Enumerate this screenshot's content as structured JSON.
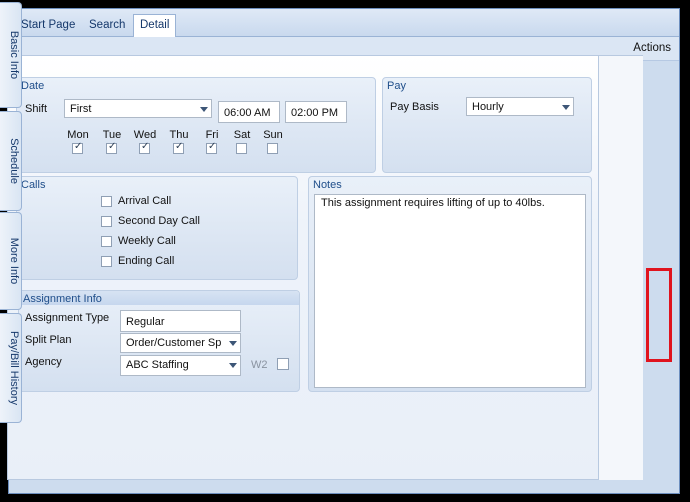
{
  "tabs": [
    "Start Page",
    "Search",
    "Detail"
  ],
  "actions_label": "Actions",
  "side_tabs": [
    "Basic Info",
    "Schedule",
    "More Info",
    "Pay/Bill History"
  ],
  "date_group": {
    "title": "Date",
    "shift_label": "Shift",
    "shift_value": "First",
    "start_time": "06:00 AM",
    "end_time": "02:00 PM",
    "days": [
      {
        "label": "Mon",
        "checked": true
      },
      {
        "label": "Tue",
        "checked": true
      },
      {
        "label": "Wed",
        "checked": true
      },
      {
        "label": "Thu",
        "checked": true
      },
      {
        "label": "Fri",
        "checked": true
      },
      {
        "label": "Sat",
        "checked": false
      },
      {
        "label": "Sun",
        "checked": false
      }
    ]
  },
  "pay_group": {
    "title": "Pay",
    "basis_label": "Pay Basis",
    "basis_value": "Hourly"
  },
  "calls_group": {
    "title": "Calls",
    "items": [
      {
        "label": "Arrival Call",
        "checked": false
      },
      {
        "label": "Second Day Call",
        "checked": false
      },
      {
        "label": "Weekly Call",
        "checked": false
      },
      {
        "label": "Ending Call",
        "checked": false
      }
    ]
  },
  "notes_group": {
    "title": "Notes",
    "text": "This assignment requires lifting of up to 40lbs."
  },
  "assignment_group": {
    "title": "Assignment Info",
    "type_label": "Assignment Type",
    "type_value": "Regular",
    "split_label": "Split Plan",
    "split_value": "Order/Customer Sp",
    "agency_label": "Agency",
    "agency_value": "ABC Staffing",
    "w2_label": "W2"
  },
  "colors": {
    "highlight": "#e0141e",
    "accent": "#15386b"
  }
}
